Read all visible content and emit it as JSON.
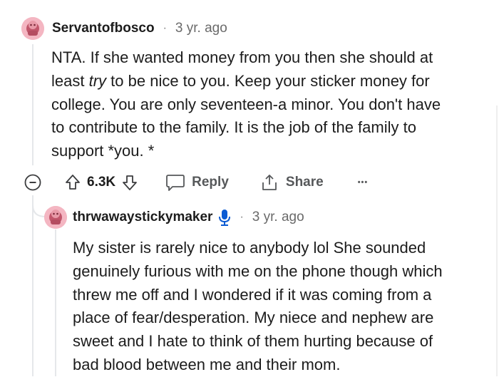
{
  "comment": {
    "username": "Servantofbosco",
    "separator": "·",
    "time": "3 yr. ago",
    "body_lines": [
      "NTA. If she wanted money from you then she should at",
      "least ",
      "try",
      " to be nice to you. Keep your sticker money for",
      "college. You are only seventeen-a minor. You don't have",
      "to contribute to the family. It is the job of the family to",
      "support *you. *"
    ]
  },
  "actions": {
    "vote_count": "6.3K",
    "reply_label": "Reply",
    "share_label": "Share",
    "more_label": "•••"
  },
  "reply": {
    "username": "thrwawaystickymaker",
    "separator": "·",
    "time": "3 yr. ago",
    "body_lines": [
      "My sister is rarely nice to anybody lol She sounded",
      "genuinely furious with me on the phone though which",
      "threw me off and I wondered if it was coming from a",
      "place of fear/desperation. My niece and nephew are",
      "sweet and I hate to think of them hurting because of",
      "bad blood between me and their mom."
    ]
  }
}
